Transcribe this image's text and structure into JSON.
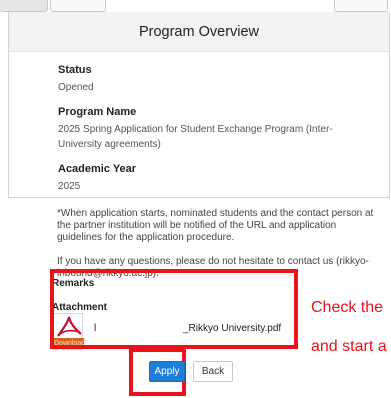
{
  "panel": {
    "title": "Program Overview",
    "fields": [
      {
        "label": "Status",
        "value": "Opened"
      },
      {
        "label": "Program Name",
        "value": "2025 Spring Application for Student Exchange Program (Inter-University agreements)"
      },
      {
        "label": "Academic Year",
        "value": "2025"
      }
    ]
  },
  "info": {
    "paragraph1": "*When application starts, nominated students and the contact person at the partner institution will be notified of the URL and application guidelines for the application procedure.",
    "paragraph2": "If you have any questions, please do not hesitate to contact us (rikkyo-inbound@rikkyo.ac.jp)."
  },
  "remarks_label": "Remarks",
  "attachment": {
    "label": "Attachment",
    "file_prefix": "l",
    "file_name": "_Rikkyo University.pdf",
    "icon_band": "Download"
  },
  "buttons": {
    "apply": "Apply",
    "back": "Back"
  },
  "annotations": {
    "line1": "Check the",
    "line2": "and start a",
    "color": "#e8141c"
  }
}
